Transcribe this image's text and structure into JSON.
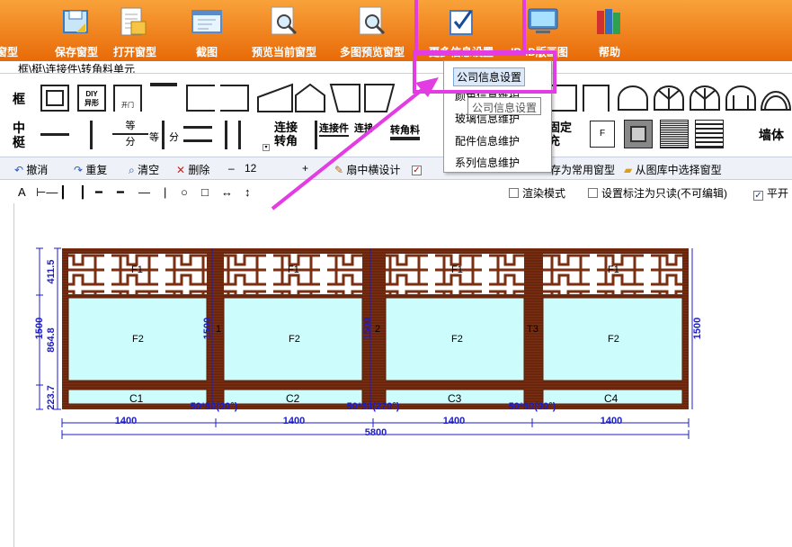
{
  "toolbar_top": {
    "buttons": [
      {
        "label": "窗型"
      },
      {
        "label": "保存窗型"
      },
      {
        "label": "打开窗型"
      },
      {
        "label": "截图"
      },
      {
        "label": "预览当前窗型"
      },
      {
        "label": "多图预览窗型"
      },
      {
        "label": "更多信息设置"
      },
      {
        "label": "IPAD版画图"
      },
      {
        "label": "帮助"
      }
    ]
  },
  "breadcrumb": "框\\梃\\连接件\\转角料单元",
  "palette": {
    "row1_label": "框",
    "row2_label": "中梃",
    "diy_label": "DIY\n异形",
    "door_label": "开门",
    "split_top": "等",
    "split_bottom": "分",
    "split_side": "等",
    "split_side2": "分",
    "connector_big": "连接转角",
    "connector1": "连接件",
    "connector2": "连接件",
    "corner_material": "转角料",
    "fix_label": "固定充",
    "f_label": "F",
    "wall_label": "墙体"
  },
  "dropdown_menu": {
    "items": [
      "公司信息设置",
      "颜色信息维护",
      "玻璃信息维护",
      "配件信息维护",
      "系列信息维护"
    ],
    "tooltip": "公司信息设置"
  },
  "edit_toolbar": {
    "undo": "撤消",
    "redo": "重复",
    "clear": "清空",
    "delete": "删除",
    "value": "12",
    "sash_design": "扇中横设计",
    "save_common": "存为常用窗型",
    "choose_library": "从图库中选择窗型"
  },
  "options": {
    "render_mode": "渲染模式",
    "render_mode_checked": false,
    "readonly_label": "设置标注为只读(不可编辑)",
    "readonly_checked": false,
    "flat_label": "平开",
    "flat_checked": true
  },
  "drawing": {
    "left_dims": [
      "411.5",
      "864.8",
      "223.7"
    ],
    "total_height": "1500",
    "panel_heights": [
      "1500",
      "1500",
      "1500"
    ],
    "mullion_labels": [
      "1",
      "2",
      "T3"
    ],
    "sash_labels": [
      "F1",
      "F1",
      "F1",
      "F1"
    ],
    "glass_labels": [
      "F2",
      "F2",
      "F2",
      "F2"
    ],
    "bottom_labels": [
      "C1",
      "C2",
      "C3",
      "C4"
    ],
    "joint_labels": [
      "50*50(90°)",
      "50*50(270°)",
      "50*50(90°)"
    ],
    "widths": [
      "1400",
      "1400",
      "1400",
      "1400"
    ],
    "total_width": "5800"
  },
  "colors": {
    "toolbar_orange": "#f28a1e",
    "frame_wood": "#7a2f12",
    "glass": "#cdfcfc",
    "dimension": "#1d1dc8",
    "highlight": "#e23ce2"
  }
}
